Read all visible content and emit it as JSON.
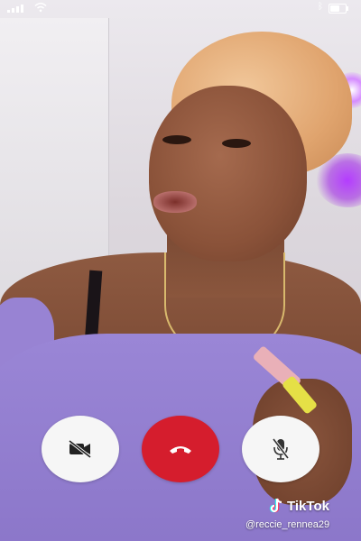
{
  "status_bar": {
    "signal_bars": 4,
    "battery_level": 0.6
  },
  "call_controls": {
    "video": {
      "icon": "video-off-icon",
      "state": "off"
    },
    "end": {
      "icon": "hang-up-icon",
      "color": "#d51d2d"
    },
    "mute": {
      "icon": "mic-off-icon",
      "state": "muted"
    }
  },
  "watermark": {
    "brand": "TikTok",
    "username": "@reccie_rennea29"
  }
}
